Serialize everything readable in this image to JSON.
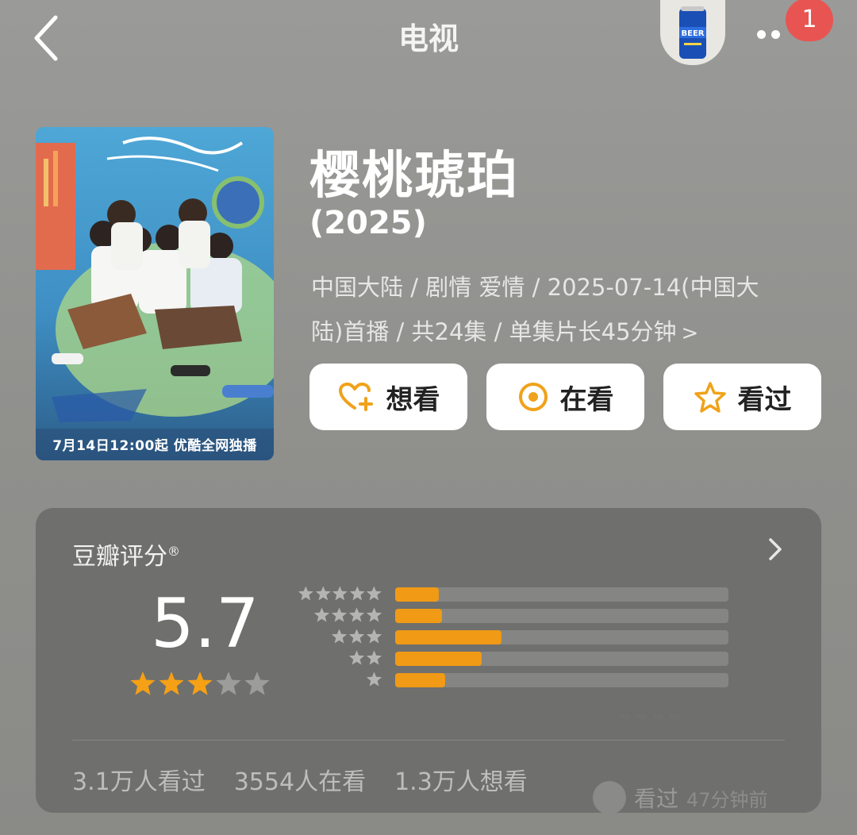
{
  "header": {
    "title": "电视",
    "notification_count": "1",
    "beer_label": "BEER"
  },
  "poster": {
    "caption": "7月14日12:00起 优酷全网独播"
  },
  "show": {
    "title": "樱桃琥珀",
    "year": "(2025)",
    "meta_line1": "中国大陆 / 剧情 爱情 / 2025-07-14(中国大",
    "meta_line2": "陆)首播 / 共24集 / 单集片长45分钟",
    "chevron": ">"
  },
  "actions": [
    {
      "label": "想看",
      "icon": "heart-plus-icon"
    },
    {
      "label": "在看",
      "icon": "target-icon"
    },
    {
      "label": "看过",
      "icon": "star-outline-icon"
    }
  ],
  "rating": {
    "title": "豆瓣评分",
    "registered_mark": "®",
    "score": "5.7",
    "score_stars": 3,
    "distribution": [
      {
        "stars": 5,
        "fraction": 0.13
      },
      {
        "stars": 4,
        "fraction": 0.14
      },
      {
        "stars": 3,
        "fraction": 0.32
      },
      {
        "stars": 2,
        "fraction": 0.26
      },
      {
        "stars": 1,
        "fraction": 0.15
      }
    ]
  },
  "stats": {
    "watched": "3.1万人看过",
    "watching": "3554人在看",
    "want": "1.3万人想看"
  },
  "history": {
    "label": "看过",
    "time": "47分钟前"
  },
  "colors": {
    "accent": "#f09a16",
    "star_on": "#f5a015",
    "star_off": "#9c9c9a",
    "badge": "#e85451"
  }
}
